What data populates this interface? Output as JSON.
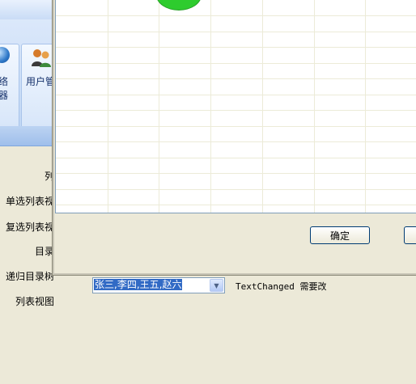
{
  "ribbon": {
    "buttons": [
      {
        "label_line1": "络",
        "label_line2": "器"
      },
      {
        "label": "用户管"
      }
    ]
  },
  "left_labels": [
    "列",
    "单选列表视",
    "复选列表视",
    "目录",
    "递归目录树",
    "列表视图"
  ],
  "dialog": {
    "ok_label": "确定",
    "grid_rows": 13,
    "grid_cols": 7
  },
  "combo": {
    "value": "张三,李四,王五,赵六"
  },
  "note": "TextChanged 需要改"
}
